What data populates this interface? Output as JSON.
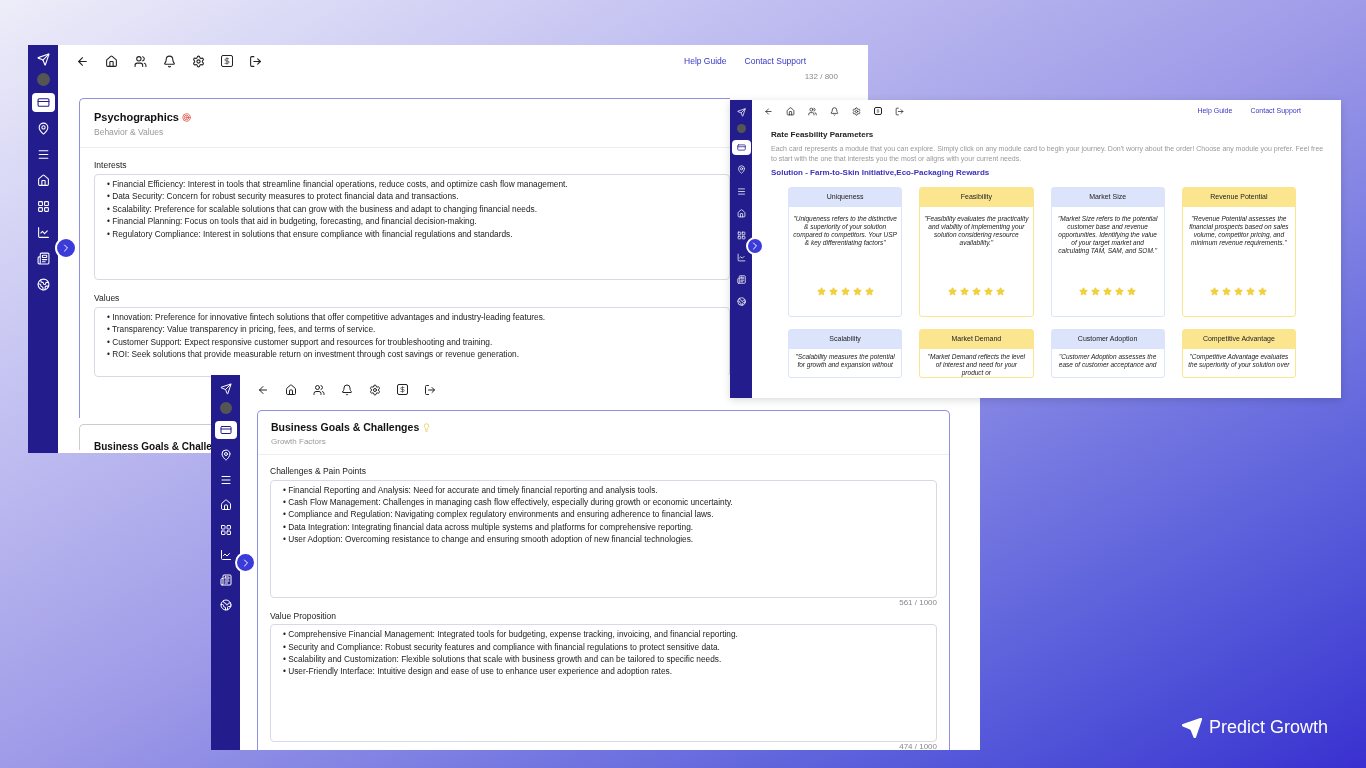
{
  "persona_window": {
    "sidebar": [
      {
        "selected": true
      },
      {
        "selected": false
      },
      {
        "selected": false
      },
      {
        "selected": false
      },
      {
        "selected": false
      },
      {
        "selected": false
      },
      {
        "selected": false
      },
      {
        "selected": false
      }
    ],
    "links": [
      "Help Guide",
      "Contact Support"
    ],
    "previous_counter": "132 / 800",
    "card": {
      "title": "Psychographics",
      "subtitle": "Behavior & Values",
      "sections": [
        {
          "label": "Interests",
          "lines": [
            "• Financial Efficiency: Interest in tools that streamline financial operations, reduce costs, and optimize cash flow management.",
            "• Data Security: Concern for robust security measures to protect financial data and transactions.",
            "• Scalability: Preference for scalable solutions that can grow with the business and adapt to changing financial needs.",
            "• Financial Planning: Focus on tools that aid in budgeting, forecasting, and financial decision-making.",
            "• Regulatory Compliance: Interest in solutions that ensure compliance with financial regulations and standards."
          ]
        },
        {
          "label": "Values",
          "lines": [
            "• Innovation: Preference for innovative fintech solutions that offer competitive advantages and industry-leading features.",
            "• Transparency: Value transparency in pricing, fees, and terms of service.",
            "• Customer Support: Expect responsive customer support and resources for troubleshooting and training.",
            "• ROI: Seek solutions that provide measurable return on investment through cost savings or revenue generation."
          ]
        }
      ]
    },
    "next_card_title": "Business Goals & Challe"
  },
  "goals_window": {
    "sidebar": [
      {
        "selected": true
      },
      {
        "selected": false
      },
      {
        "selected": false
      },
      {
        "selected": false
      },
      {
        "selected": false
      },
      {
        "selected": false
      },
      {
        "selected": false
      },
      {
        "selected": false
      }
    ],
    "card": {
      "title": "Business Goals & Challenges",
      "subtitle": "Growth Factors",
      "sections": [
        {
          "label": "Challenges & Pain Points",
          "counter": "561 / 1000",
          "lines": [
            "• Financial Reporting and Analysis: Need for accurate and timely financial reporting and analysis tools.",
            "• Cash Flow Management: Challenges in managing cash flow effectively, especially during growth or economic uncertainty.",
            "• Compliance and Regulation: Navigating complex regulatory environments and ensuring adherence to financial laws.",
            "• Data Integration: Integrating financial data across multiple systems and platforms for comprehensive reporting.",
            "• User Adoption: Overcoming resistance to change and ensuring smooth adoption of new financial technologies."
          ]
        },
        {
          "label": "Value Proposition",
          "counter": "474 / 1000",
          "lines": [
            "• Comprehensive Financial Management: Integrated tools for budgeting, expense tracking, invoicing, and financial reporting.",
            "• Security and Compliance: Robust security features and compliance with financial regulations to protect sensitive data.",
            "• Scalability and Customization: Flexible solutions that scale with business growth and can be tailored to specific needs.",
            "• User-Friendly Interface: Intuitive design and ease of use to enhance user experience and adoption rates."
          ]
        }
      ]
    }
  },
  "feasibility_window": {
    "sidebar": [
      {
        "selected": true
      },
      {
        "selected": false
      },
      {
        "selected": false
      },
      {
        "selected": false
      },
      {
        "selected": false
      },
      {
        "selected": false
      },
      {
        "selected": false
      },
      {
        "selected": false
      }
    ],
    "links": [
      "Help Guide",
      "Contact Support"
    ],
    "title": "Rate Feasbility Parameters",
    "description": "Each card represents a module that you can explore. Simply click on any module card to begin your journey. Don't worry about the order! Choose any module you prefer. Feel free to start with the one that interests you the most or aligns with your current needs.",
    "solution": "Solution - Farm-to-Skin Initiative,Eco-Packaging Rewards",
    "cards": [
      {
        "title": "Uniqueness",
        "color": "#dce4fb",
        "text": "\"Uniqueness refers to the distinctive & superiority of your solution compared to competitors. Your USP & key differentiating factors\"",
        "stars": 5
      },
      {
        "title": "Feasibility",
        "color": "#fbe58f",
        "text": "\"Feasibility evaluates the practicality and viability of implementing your solution considering resource availability.\"",
        "stars": 5
      },
      {
        "title": "Market Size",
        "color": "#dce4fb",
        "text": "\"Market Size refers to the potential customer base and revenue opportunities. Identifying the value of your target market and calculating TAM, SAM, and SOM.\"",
        "stars": 5
      },
      {
        "title": "Revenue Potential",
        "color": "#fbe58f",
        "text": "\"Revenue Potential assesses the financial prospects based on sales volume, competitor pricing, and minimum revenue requirements.\"",
        "stars": 5
      },
      {
        "title": "Scalability",
        "color": "#dce4fb",
        "text": "\"Scalability measures the potential for growth and expansion without"
      },
      {
        "title": "Market Demand",
        "color": "#fbe58f",
        "text": "\"Market Demand reflects the level of interest and need for your product or"
      },
      {
        "title": "Customer Adoption",
        "color": "#dce4fb",
        "text": "\"Customer Adoption assesses the ease of customer acceptance and"
      },
      {
        "title": "Competitive Advantage",
        "color": "#fbe58f",
        "text": "\"Competitive Advantage evaluates the superiority of your solution over"
      }
    ]
  },
  "brand": {
    "name": "Predict Growth"
  }
}
